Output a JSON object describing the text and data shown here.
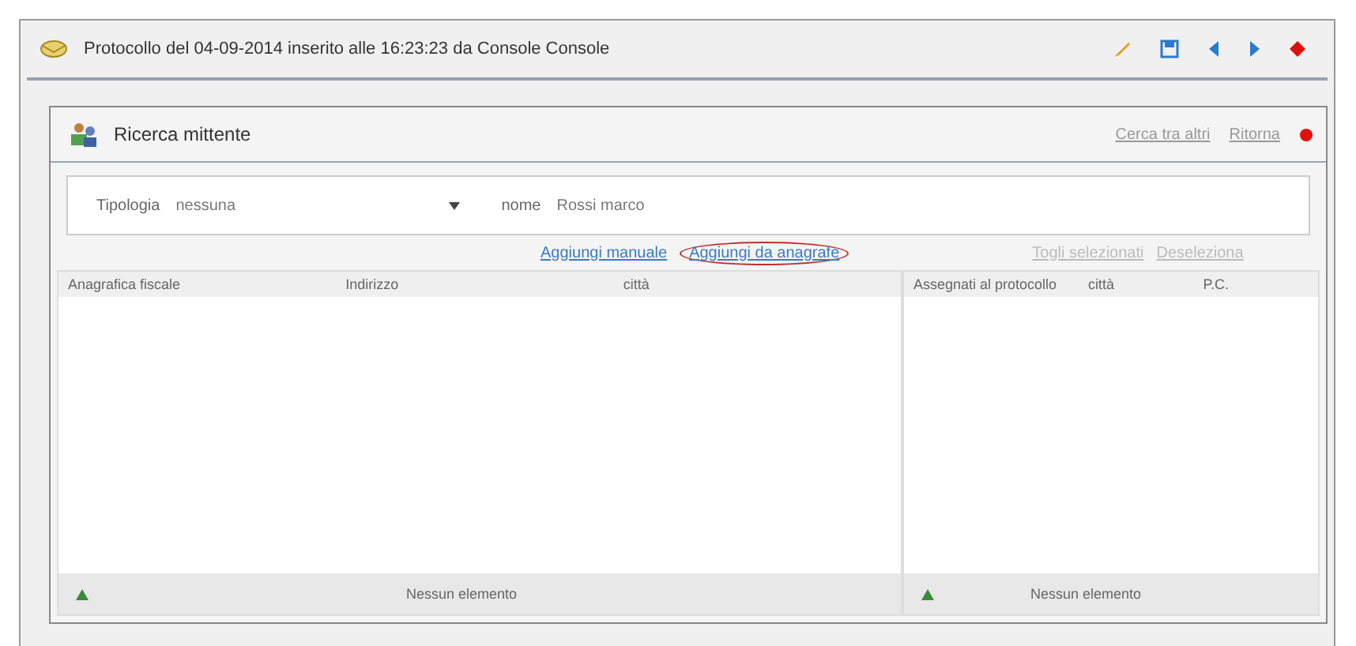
{
  "protocol_bar": {
    "title": "Protocollo del  04-09-2014  inserito alle   16:23:23  da  Console Console"
  },
  "dialog": {
    "title": "Ricerca mittente",
    "header_links": [
      "Cerca tra altri",
      "Ritorna"
    ],
    "filters": [
      {
        "label": "Tipologia",
        "kind": "select",
        "value": "nessuna"
      },
      {
        "label": "nome",
        "kind": "text",
        "value": "Rossi marco"
      }
    ],
    "actions": [
      {
        "label": "Aggiungi manuale",
        "highlighted": false,
        "enabled": true
      },
      {
        "label": "Aggiungi da anagrafe",
        "highlighted": true,
        "enabled": true
      },
      {
        "label": "Togli selezionati",
        "highlighted": false,
        "enabled": false
      },
      {
        "label": "Deseleziona",
        "highlighted": false,
        "enabled": false
      }
    ],
    "left_table": {
      "columns": [
        "Anagrafica fiscale",
        "Indirizzo",
        "città"
      ],
      "footer": "Nessun elemento"
    },
    "right_table": {
      "columns": [
        "Assegnati al protocollo",
        "città",
        "P.C."
      ],
      "footer": "Nessun elemento"
    }
  }
}
